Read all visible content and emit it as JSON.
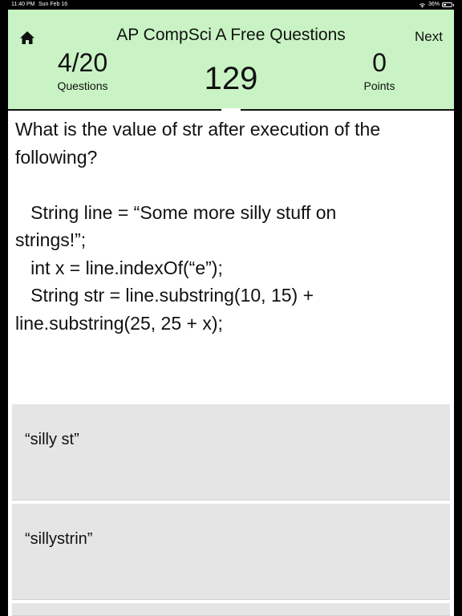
{
  "status_bar": {
    "time": "11:40 PM",
    "date": "Sun Feb 16",
    "battery": "36%",
    "battery_level": 0.36
  },
  "header": {
    "title": "AP CompSci A Free Questions",
    "next_label": "Next",
    "home_icon": "home-icon",
    "questions_value": "4/20",
    "questions_label": "Questions",
    "timer": "129",
    "points_value": "0",
    "points_label": "Points",
    "background_color": "#c9f3c4"
  },
  "question": {
    "lines": [
      "What is the value of str after execution of the",
      "following?",
      "",
      "   String line = “Some more silly stuff on",
      "strings!”;",
      "   int x = line.indexOf(“e”);",
      "   String str = line.substring(10, 15) +",
      "line.substring(25, 25 + x);"
    ]
  },
  "answers": [
    {
      "text": "“silly st”"
    },
    {
      "text": "“sillystrin”"
    },
    {
      "text": ""
    }
  ]
}
